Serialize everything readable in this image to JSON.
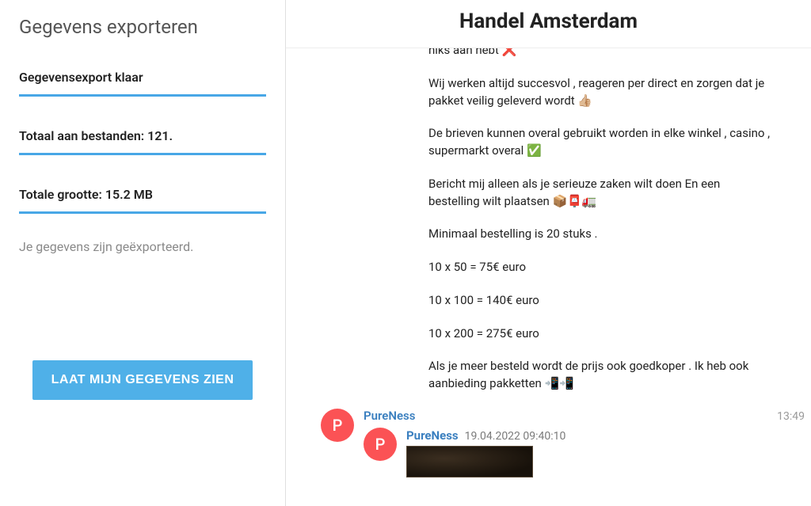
{
  "sidebar": {
    "title": "Gegevens exporteren",
    "status": "Gegevensexport klaar",
    "files_line": "Totaal aan bestanden: 121.",
    "size_line": "Totale grootte: 15.2 MB",
    "exported_note": "Je gegevens zijn geëxporteerd.",
    "show_button": "LAAT MIJN GEGEVENS ZIEN"
  },
  "main": {
    "title": "Handel Amsterdam",
    "message": {
      "line0": "niks aan hebt ❌",
      "line1": "Wij werken altijd succesvol , reageren per direct en zorgen dat je pakket veilig geleverd wordt 👍🏼",
      "line2": "De brieven kunnen overal gebruikt worden in elke winkel , casino , supermarkt overal ✅",
      "line3": "Bericht mij alleen als je serieuze zaken wilt doen En een bestelling wilt plaatsen 📦📮🚛",
      "line4": "Minimaal bestelling is 20 stuks .",
      "line5": "10 x 50 = 75€ euro",
      "line6": "10 x 100 = 140€ euro",
      "line7": "10 x 200 = 275€ euro",
      "line8": "Als je meer besteld wordt de prijs ook goedkoper . Ik heb ook aanbieding pakketten 📲📲"
    },
    "reply": {
      "avatar_letter": "P",
      "sender": "PureNess",
      "time": "13:49",
      "quoted_avatar_letter": "P",
      "quoted_sender": "PureNess",
      "quoted_ts": "19.04.2022 09:40:10"
    }
  }
}
